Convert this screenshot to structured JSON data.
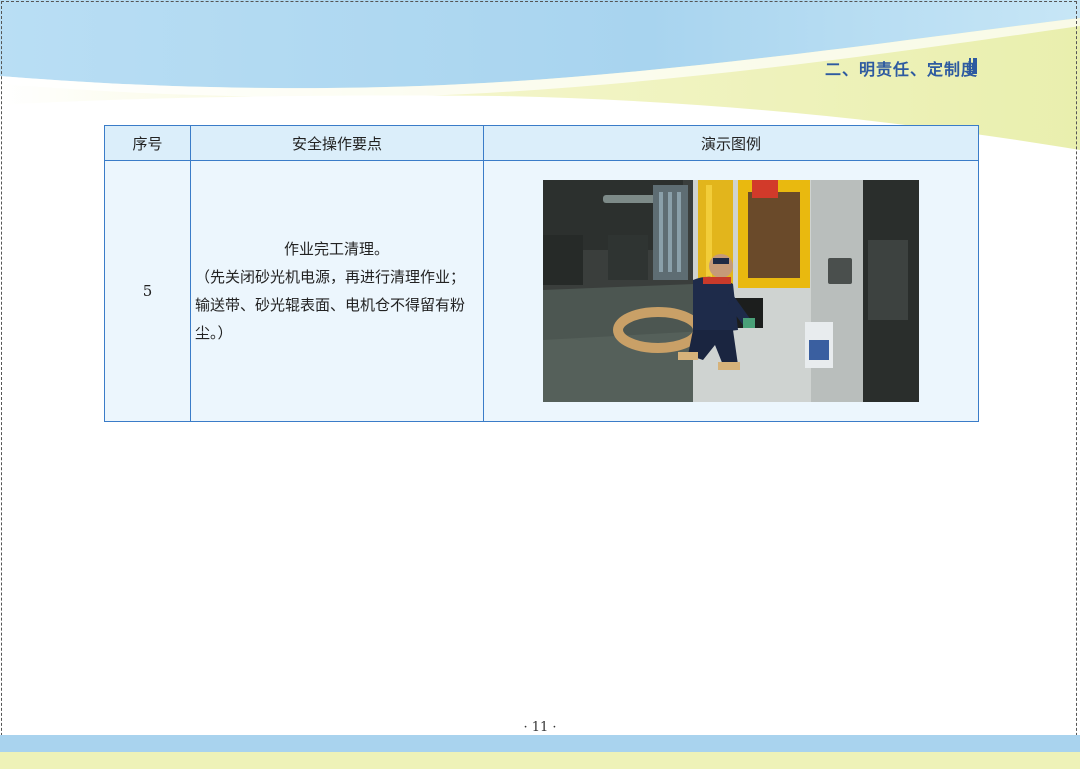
{
  "header": {
    "section_title": "二、明责任、定制度"
  },
  "table": {
    "columns": [
      "序号",
      "安全操作要点",
      "演示图例"
    ],
    "rows": [
      {
        "no": "5",
        "points_title": "作业完工清理。",
        "points_body": "（先关闭砂光机电源，再进行清理作业；输送带、砂光辊表面、电机仓不得留有粉尘。）"
      }
    ]
  },
  "footer": {
    "page_number": "· 11 ·"
  },
  "colors": {
    "accent_blue": "#2d5aa0",
    "table_border": "#3a7cc8",
    "header_cell_bg": "#dbeefa",
    "body_cell_bg": "#ecf6fd",
    "band_blue": "#a9d3ee",
    "band_yellow": "#eef2b8"
  }
}
